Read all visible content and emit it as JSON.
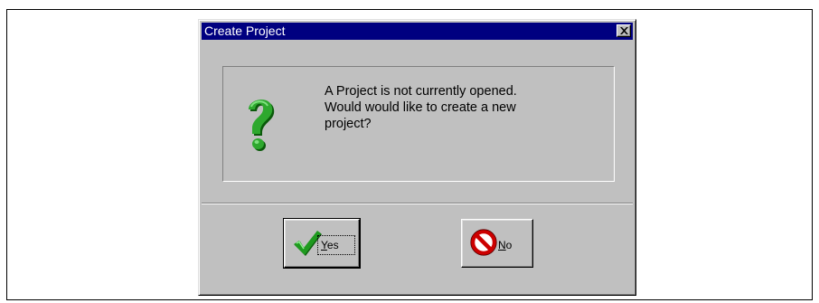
{
  "dialog": {
    "title": "Create Project",
    "message_lines": [
      "A Project is not currently opened.",
      "Would would like to create a new",
      "project?"
    ],
    "icons": {
      "close": "close-icon",
      "question": "question-icon",
      "yes": "checkmark-icon",
      "no": "prohibited-icon"
    },
    "buttons": {
      "yes": {
        "mnemonic": "Y",
        "rest": "es"
      },
      "no": {
        "mnemonic": "N",
        "rest": "o"
      }
    },
    "colors": {
      "title_bar": "#000080",
      "face": "#c0c0c0",
      "check_green": "#1f9a1f",
      "no_red": "#cc0000"
    }
  }
}
